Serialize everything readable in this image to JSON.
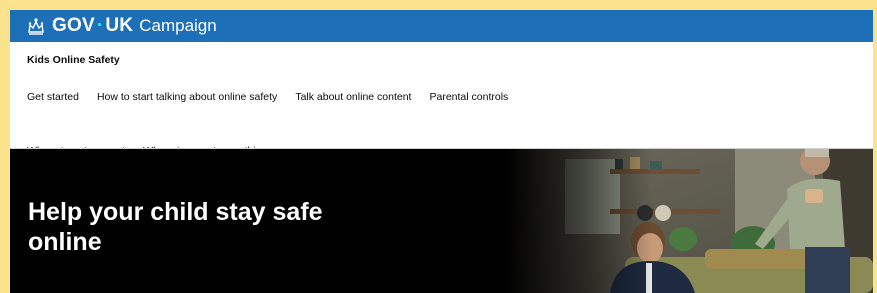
{
  "header": {
    "brand_left": "GOV",
    "brand_dot": "·",
    "brand_right": "UK",
    "campaign": "Campaign"
  },
  "service": {
    "name": "Kids Online Safety"
  },
  "nav": {
    "items": [
      "Get started",
      "How to start talking about online safety",
      "Talk about online content",
      "Parental controls",
      "Where to get support",
      "Where to report something"
    ]
  },
  "hero": {
    "title": "Help your child stay safe online"
  },
  "colors": {
    "page_background": "#fbe38e",
    "header_blue": "#1d70b8",
    "hero_background": "#000000",
    "text": "#0b0c0c"
  },
  "icons": {
    "brand": "crown-icon"
  }
}
